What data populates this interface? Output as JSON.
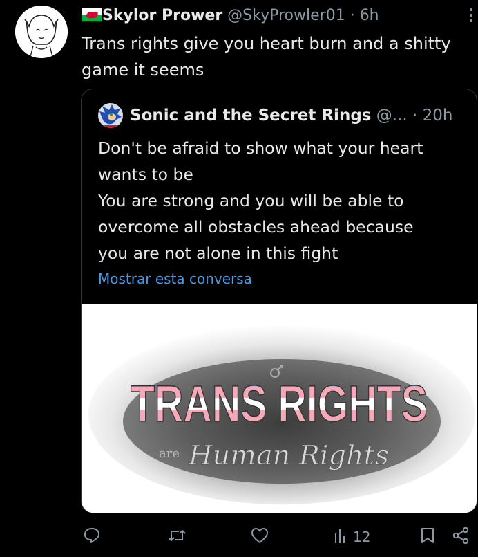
{
  "tweet": {
    "author_name": "Skylor Prower",
    "author_flag": "🏴󠁧󠁢󠁷󠁬󠁳󠁿",
    "handle": "@SkyProwler01",
    "time": "· 6h",
    "text_line1": "Trans rights give you heart burn and a shitty",
    "text_line2": "game it seems"
  },
  "quote": {
    "author_name": "Sonic and the Secret Rings",
    "handle": "@...",
    "time": "· 20h",
    "lines": [
      "Don't be afraid to show what your heart",
      "wants to be",
      "You are strong and you will be able to",
      "overcome all obstacles ahead because",
      "you are not alone in this fight"
    ],
    "show_conversation": "Mostrar esta conversa",
    "image_title": "TRANS RIGHTS",
    "image_subtitle_small": "are",
    "image_subtitle": "Human Rights"
  },
  "actions": {
    "reply_icon": "reply-icon",
    "retweet_icon": "retweet-icon",
    "like_icon": "like-icon",
    "views_icon": "views-icon",
    "views_count": "12",
    "bookmark_icon": "bookmark-icon",
    "share_icon": "share-icon"
  },
  "colors": {
    "background": "#000000",
    "text": "#e7e9ea",
    "secondary": "#8b98a5",
    "link": "#4a99e9",
    "trans_blue": "#5bcefa",
    "trans_pink": "#f5a9b8"
  }
}
